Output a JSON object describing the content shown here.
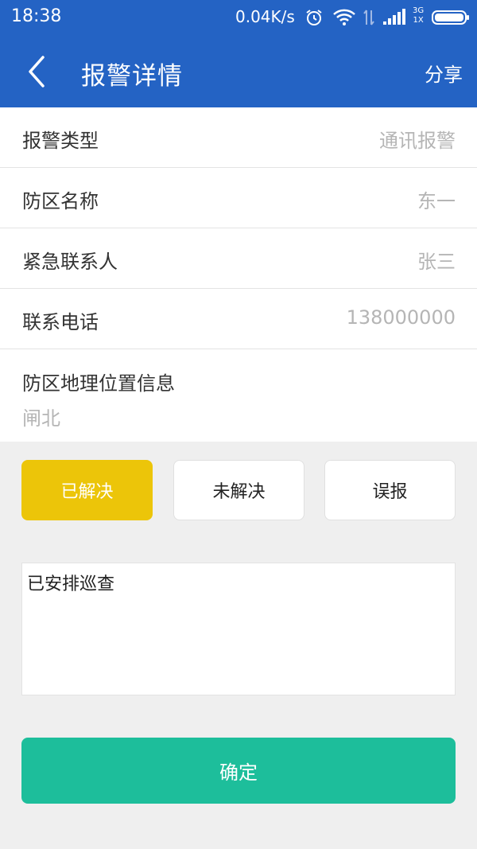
{
  "status_bar": {
    "time": "18:38",
    "net_speed": "0.04K/s",
    "net_type_top": "3G",
    "net_type_bottom": "1X",
    "icons": [
      "alarm-clock-icon",
      "wifi-icon",
      "data-transfer-icon",
      "signal-icon",
      "battery-icon"
    ]
  },
  "header": {
    "title": "报警详情",
    "share_label": "分享",
    "background": "#2463c4"
  },
  "details": {
    "alarm_type_label": "报警类型",
    "alarm_type_value": "通讯报警",
    "zone_name_label": "防区名称",
    "zone_name_value": "东一",
    "contact_label": "紧急联系人",
    "contact_value": "张三",
    "phone_label": "联系电话",
    "phone_value": "138000000",
    "location_label": "防区地理位置信息",
    "location_value": "闸北"
  },
  "status_options": {
    "resolved": "已解决",
    "unresolved": "未解决",
    "false_alarm": "误报",
    "selected": "已解决",
    "selected_color": "#ecc509"
  },
  "remark": {
    "value": "已安排巡查"
  },
  "confirm_label": "确定",
  "confirm_color": "#1dbe9b"
}
